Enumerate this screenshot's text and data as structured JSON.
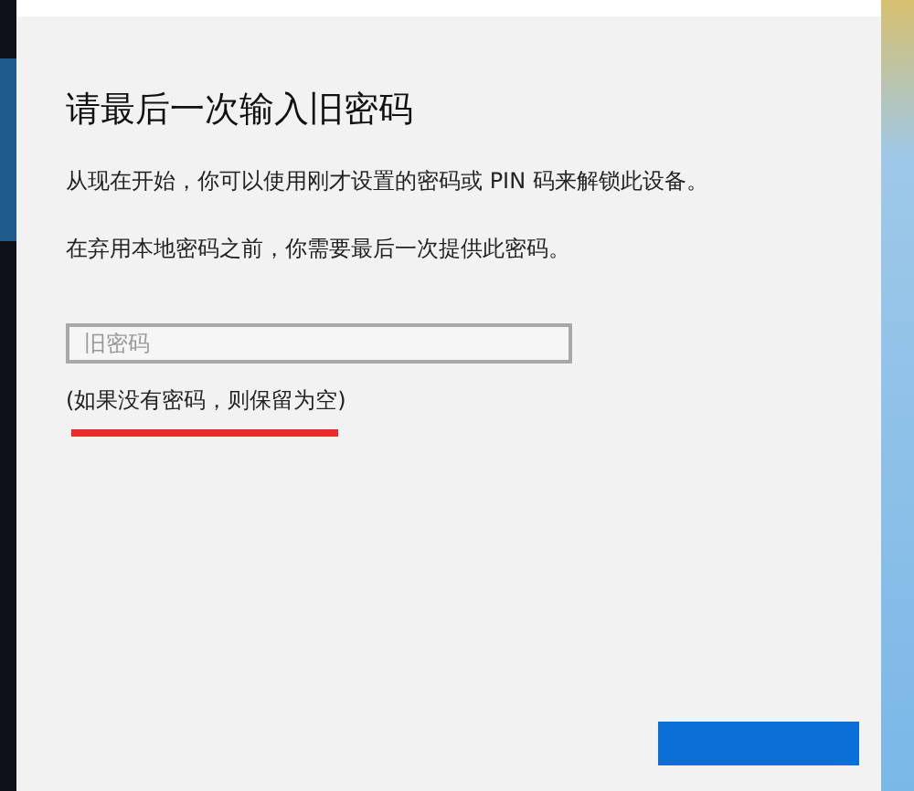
{
  "dialog": {
    "title": "请最后一次输入旧密码",
    "paragraphs": [
      "从现在开始，你可以使用刚才设置的密码或 PIN 码来解锁此设备。",
      "在弃用本地密码之前，你需要最后一次提供此密码。"
    ],
    "password_field": {
      "placeholder": "旧密码"
    },
    "hint": {
      "text": "(如果没有密码，则保留为空)",
      "underlined": true
    },
    "primary_button": {
      "disabled": false
    }
  }
}
